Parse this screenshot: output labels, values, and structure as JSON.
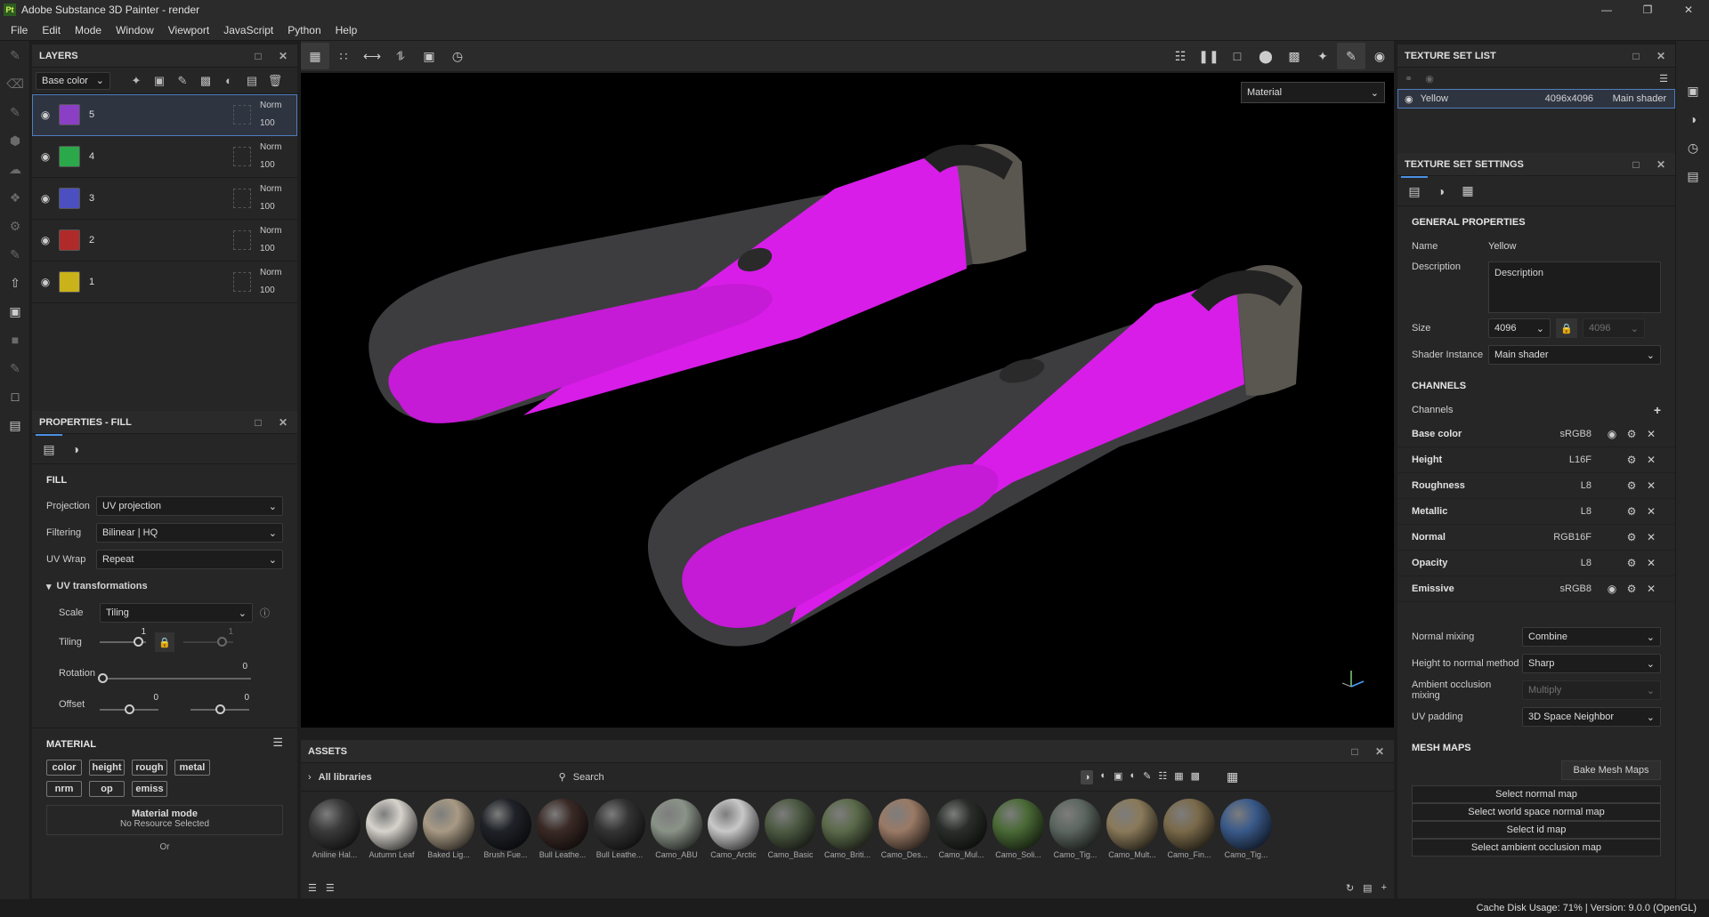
{
  "window": {
    "title": "Adobe Substance 3D Painter - render",
    "app_icon": "Pt"
  },
  "menu": [
    "File",
    "Edit",
    "Mode",
    "Window",
    "Viewport",
    "JavaScript",
    "Python",
    "Help"
  ],
  "layers": {
    "title": "LAYERS",
    "channel": "Base color",
    "items": [
      {
        "name": "5",
        "blend": "Norm",
        "opacity": "100",
        "color": "#8a3fc4"
      },
      {
        "name": "4",
        "blend": "Norm",
        "opacity": "100",
        "color": "#2aa84a"
      },
      {
        "name": "3",
        "blend": "Norm",
        "opacity": "100",
        "color": "#4b4fbf"
      },
      {
        "name": "2",
        "blend": "Norm",
        "opacity": "100",
        "color": "#b02a2a"
      },
      {
        "name": "1",
        "blend": "Norm",
        "opacity": "100",
        "color": "#c9b21a"
      }
    ]
  },
  "properties": {
    "title": "PROPERTIES - FILL",
    "fill": {
      "title": "FILL",
      "projection_label": "Projection",
      "projection": "UV projection",
      "filtering_label": "Filtering",
      "filtering": "Bilinear | HQ",
      "uvwrap_label": "UV Wrap",
      "uvwrap": "Repeat",
      "uvtrans": "UV transformations",
      "scale_label": "Scale",
      "scale": "Tiling",
      "tiling_label": "Tiling",
      "tiling_a": "1",
      "tiling_b": "1",
      "rotation_label": "Rotation",
      "rotation": "0",
      "offset_label": "Offset",
      "offset_a": "0",
      "offset_b": "0"
    },
    "material": {
      "title": "MATERIAL",
      "chips": [
        "color",
        "height",
        "rough",
        "metal",
        "nrm",
        "op",
        "emiss"
      ],
      "mode_title": "Material mode",
      "mode_value": "No Resource Selected",
      "or": "Or"
    }
  },
  "viewport": {
    "mode": "Material"
  },
  "assets": {
    "title": "ASSETS",
    "library": "All libraries",
    "search_placeholder": "Search",
    "items": [
      {
        "label": "Aniline Hal...",
        "color": "#3a3a3a"
      },
      {
        "label": "Autumn Leaf",
        "color": "#d6d2cc"
      },
      {
        "label": "Baked Lig...",
        "color": "#a89a84"
      },
      {
        "label": "Brush Fue...",
        "color": "#1f2228"
      },
      {
        "label": "Bull Leathe...",
        "color": "#3a2a26"
      },
      {
        "label": "Bull Leathe...",
        "color": "#333"
      },
      {
        "label": "Camo_ABU",
        "color": "#8a9388"
      },
      {
        "label": "Camo_Arctic",
        "color": "#c8c8c8"
      },
      {
        "label": "Camo_Basic",
        "color": "#4d5a43"
      },
      {
        "label": "Camo_Briti...",
        "color": "#5b6a4a"
      },
      {
        "label": "Camo_Des...",
        "color": "#9a7a66"
      },
      {
        "label": "Camo_Mul...",
        "color": "#2a2e2a"
      },
      {
        "label": "Camo_Soli...",
        "color": "#4a6a36"
      },
      {
        "label": "Camo_Tig...",
        "color": "#5c6660"
      },
      {
        "label": "Camo_Mult...",
        "color": "#8a7a5a"
      },
      {
        "label": "Camo_Fin...",
        "color": "#7a6a4a"
      },
      {
        "label": "Camo_Tig...",
        "color": "#3a5a8a"
      }
    ]
  },
  "texture_set_list": {
    "title": "TEXTURE SET LIST",
    "row": {
      "name": "Yellow",
      "size": "4096x4096",
      "shader": "Main shader"
    }
  },
  "texture_set_settings": {
    "title": "TEXTURE SET SETTINGS",
    "general": "GENERAL PROPERTIES",
    "name_label": "Name",
    "name": "Yellow",
    "desc_label": "Description",
    "desc": "Description",
    "size_label": "Size",
    "size": "4096",
    "size2": "4096",
    "shader_label": "Shader Instance",
    "shader": "Main shader",
    "channels_title": "CHANNELS",
    "channels_label": "Channels",
    "channels": [
      {
        "name": "Base color",
        "fmt": "sRGB8"
      },
      {
        "name": "Height",
        "fmt": "L16F"
      },
      {
        "name": "Roughness",
        "fmt": "L8"
      },
      {
        "name": "Metallic",
        "fmt": "L8"
      },
      {
        "name": "Normal",
        "fmt": "RGB16F"
      },
      {
        "name": "Opacity",
        "fmt": "L8"
      },
      {
        "name": "Emissive",
        "fmt": "sRGB8"
      }
    ],
    "normal_mixing_label": "Normal mixing",
    "normal_mixing": "Combine",
    "h2n_label": "Height to normal method",
    "h2n": "Sharp",
    "ao_label": "Ambient occlusion mixing",
    "ao": "Multiply",
    "uvpad_label": "UV padding",
    "uvpad": "3D Space Neighbor",
    "mesh_maps": "MESH MAPS",
    "bake": "Bake Mesh Maps",
    "select_normal": "Select normal map",
    "select_ws": "Select world space normal map",
    "select_id": "Select id map",
    "select_ao": "Select ambient occlusion map"
  },
  "status": "Cache Disk Usage:   71% | Version: 9.0.0 (OpenGL)"
}
